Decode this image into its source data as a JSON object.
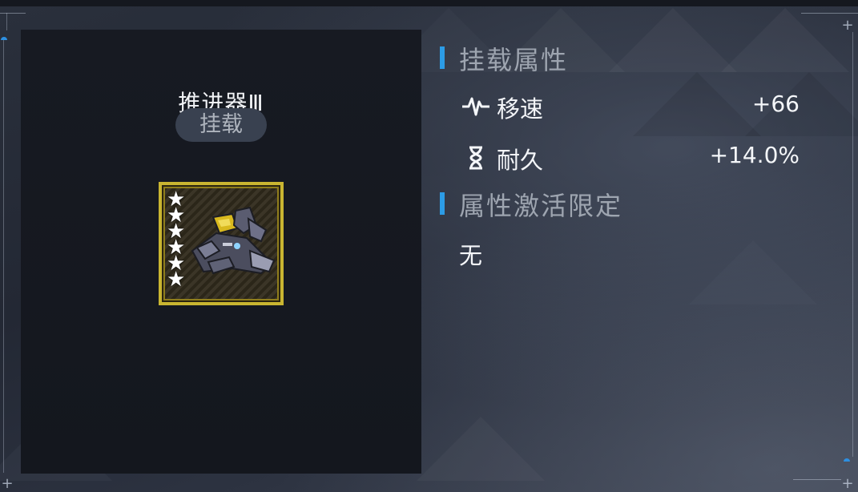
{
  "item": {
    "name": "推进器Ⅲ",
    "tag": "挂载",
    "stars": [
      "★",
      "★",
      "★",
      "★",
      "★",
      "★"
    ],
    "frame_color": "#c9b531"
  },
  "mount_attributes": {
    "title": "挂载属性",
    "rows": [
      {
        "icon": "speed-pulse-icon",
        "name": "移速",
        "value": "+66"
      },
      {
        "icon": "hourglass-icon",
        "name": "耐久",
        "value": "+14.0%"
      }
    ]
  },
  "activation": {
    "title": "属性激活限定",
    "value": "无"
  },
  "colors": {
    "accent": "#2c9ce6",
    "panel_bg": "#151820",
    "tag_bg": "#394150"
  }
}
